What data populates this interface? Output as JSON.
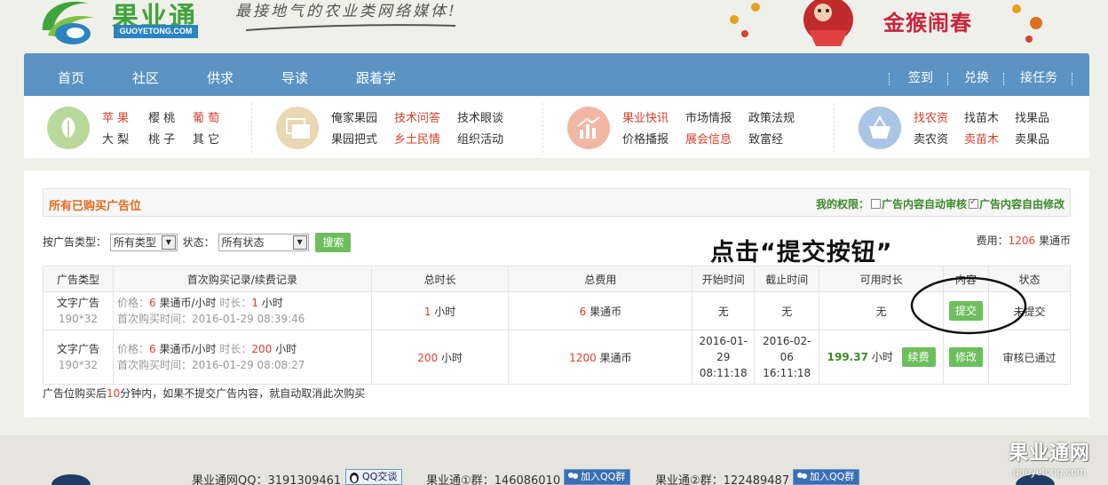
{
  "header": {
    "logo_text": "果业通",
    "logo_domain": "GUOYETONG.COM",
    "slogan": "最接地气的农业类网络媒体!",
    "festive_text": "金猴闹春"
  },
  "nav": {
    "items": [
      "首页",
      "社区",
      "供求",
      "导读",
      "跟着学"
    ],
    "right_items": [
      "签到",
      "兑换",
      "接任务"
    ]
  },
  "categories": {
    "g1": [
      "苹 果",
      "樱 桃",
      "葡 萄",
      "大 梨",
      "桃 子",
      "其 它"
    ],
    "g2": [
      "俺家果园",
      "技术问答",
      "技术眼谈",
      "果园把式",
      "乡土民情",
      "组织活动"
    ],
    "g3": [
      "果业快讯",
      "市场情报",
      "政策法规",
      "价格播报",
      "展会信息",
      "致富经"
    ],
    "g4": [
      "找农资",
      "找苗木",
      "找果品",
      "卖农资",
      "卖苗木",
      "卖果品"
    ]
  },
  "panel": {
    "title": "所有已购买广告位",
    "perm_label": "我的权限：",
    "perm_auto_review": "广告内容自动审核",
    "perm_auto_review_checked": false,
    "perm_free_edit": "广告内容自由修改",
    "perm_free_edit_checked": true
  },
  "filters": {
    "type_label": "按广告类型：",
    "type_value": "所有类型",
    "status_label": "状态：",
    "status_value": "所有状态",
    "search_button": "搜索"
  },
  "fee": {
    "label": "费用：",
    "value": "1206",
    "unit": "果通币"
  },
  "annotation": "点击“提交按钮”",
  "table": {
    "headers": [
      "广告类型",
      "首次购买记录/续费记录",
      "总时长",
      "总费用",
      "开始时间",
      "截止时间",
      "可用时长",
      "内容",
      "状态"
    ],
    "rows": [
      {
        "type": "文字广告",
        "size": "190*32",
        "price_label": "价格：",
        "price": "6",
        "price_unit": "果通币/小时",
        "dur_label": "时长：",
        "dur": "1",
        "dur_unit": "小时",
        "first_label": "首次购买时间：",
        "first_time": "2016-01-29 08:39:46",
        "total_dur": "1",
        "total_dur_unit": "小时",
        "total_fee": "6",
        "total_fee_unit": "果通币",
        "start": "无",
        "end": "无",
        "avail": "无",
        "content_button": "提交",
        "status": "未提交"
      },
      {
        "type": "文字广告",
        "size": "190*32",
        "price_label": "价格：",
        "price": "6",
        "price_unit": "果通币/小时",
        "dur_label": "时长：",
        "dur": "200",
        "dur_unit": "小时",
        "first_label": "首次购买时间：",
        "first_time": "2016-01-29 08:08:27",
        "total_dur": "200",
        "total_dur_unit": "小时",
        "total_fee": "1200",
        "total_fee_unit": "果通币",
        "start_date_a": "2016-01-",
        "start_date_b": "29",
        "start_time": "08:11:18",
        "end_date_a": "2016-02-",
        "end_date_b": "06",
        "end_time": "16:11:18",
        "avail": "199.37",
        "avail_unit": "小时",
        "renew_button": "续费",
        "content_button": "修改",
        "status": "审核已通过"
      }
    ]
  },
  "note": {
    "prefix": "广告位购买后",
    "minutes": "10",
    "suffix": "分钟内，如果不提交广告内容，就自动取消此次购买"
  },
  "footer": {
    "qq_label": "果业通网QQ：3191309461",
    "qq_chat": "QQ交谈",
    "group1_label": "果业通①群：146086010",
    "group1_join": "加入QQ群",
    "group2_label": "果业通②群：122489487",
    "group2_join": "加入QQ群",
    "watermark_big": "果业通网",
    "watermark_small": "guoyetong.com"
  },
  "colors": {
    "nav_bg": "#5a93c4",
    "accent_green": "#6dbf5d",
    "accent_orange": "#e06c1a",
    "accent_red": "#d9402b"
  }
}
